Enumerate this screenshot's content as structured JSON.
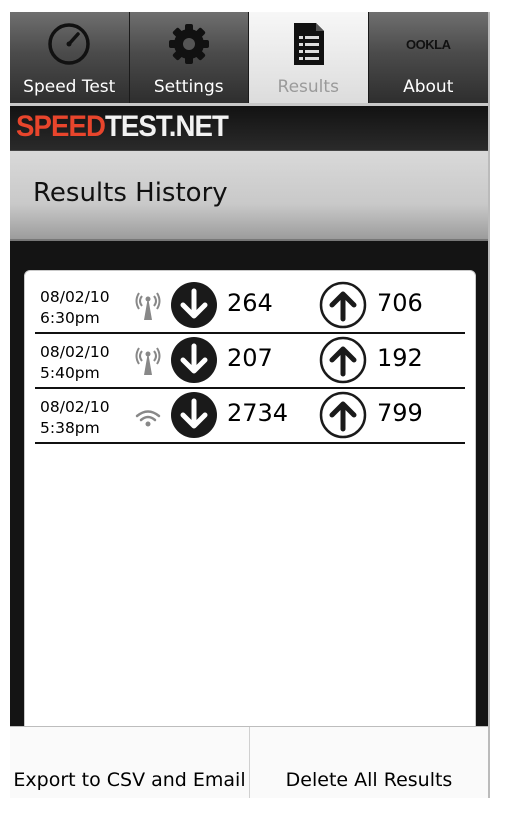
{
  "tabs": [
    {
      "label": "Speed Test",
      "icon": "speedometer-icon",
      "active": false
    },
    {
      "label": "Settings",
      "icon": "gear-icon",
      "active": false
    },
    {
      "label": "Results",
      "icon": "document-icon",
      "active": true
    },
    {
      "label": "About",
      "icon": "ookla-logo",
      "active": false
    }
  ],
  "about_logo_text": "OOKLA",
  "brand": {
    "speed": "SPEED",
    "testnet": "TEST.NET"
  },
  "header": {
    "title": "Results History"
  },
  "results": [
    {
      "date": "08/02/10",
      "time": "6:30pm",
      "connection": "cell-tower-icon",
      "download": "264",
      "upload": "706"
    },
    {
      "date": "08/02/10",
      "time": "5:40pm",
      "connection": "cell-tower-icon",
      "download": "207",
      "upload": "192"
    },
    {
      "date": "08/02/10",
      "time": "5:38pm",
      "connection": "wifi-icon",
      "download": "2734",
      "upload": "799"
    }
  ],
  "buttons": {
    "export": "Export to CSV and Email",
    "delete": "Delete All Results"
  },
  "colors": {
    "brand_red": "#e8452c",
    "tab_active_text": "#9a9a9a",
    "dark_bg": "#141414"
  }
}
